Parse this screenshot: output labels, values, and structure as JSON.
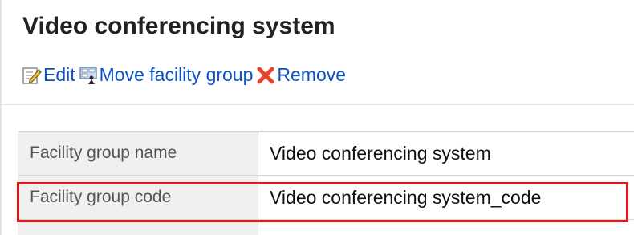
{
  "page": {
    "title": "Video conferencing system"
  },
  "toolbar": {
    "edit_label": "Edit",
    "move_label": "Move facility group",
    "remove_label": "Remove",
    "edit_icon": "edit-icon",
    "move_icon": "move-group-icon",
    "remove_icon": "remove-x-icon",
    "link_color": "#0b53c7",
    "remove_color": "#e8432c"
  },
  "details": {
    "rows": [
      {
        "label": "Facility group name",
        "value": "Video conferencing system"
      },
      {
        "label": "Facility group code",
        "value": "Video conferencing system_code"
      }
    ]
  },
  "highlight": {
    "target": "Facility group code",
    "color": "#e8141c"
  }
}
